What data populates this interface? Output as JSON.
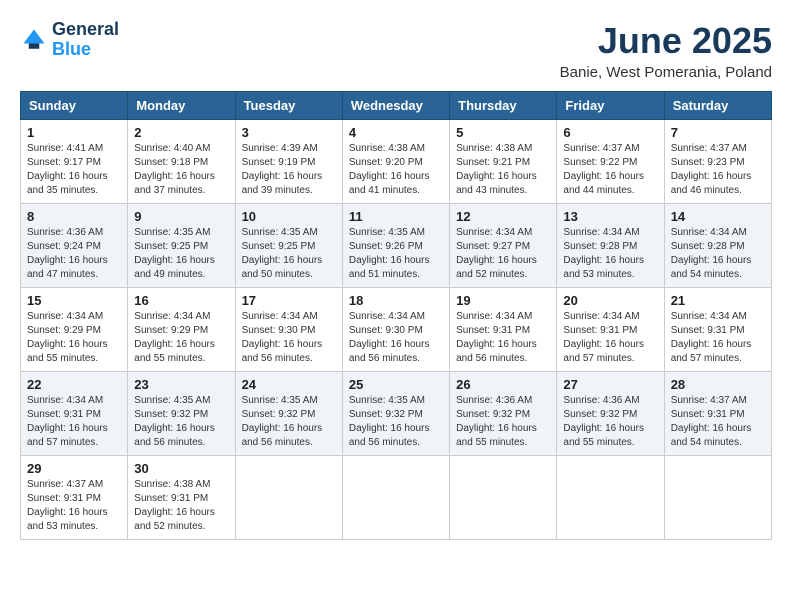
{
  "header": {
    "logo_line1": "General",
    "logo_line2": "Blue",
    "title": "June 2025",
    "subtitle": "Banie, West Pomerania, Poland"
  },
  "weekdays": [
    "Sunday",
    "Monday",
    "Tuesday",
    "Wednesday",
    "Thursday",
    "Friday",
    "Saturday"
  ],
  "weeks": [
    [
      {
        "day": "1",
        "sunrise": "4:41 AM",
        "sunset": "9:17 PM",
        "daylight": "16 hours and 35 minutes."
      },
      {
        "day": "2",
        "sunrise": "4:40 AM",
        "sunset": "9:18 PM",
        "daylight": "16 hours and 37 minutes."
      },
      {
        "day": "3",
        "sunrise": "4:39 AM",
        "sunset": "9:19 PM",
        "daylight": "16 hours and 39 minutes."
      },
      {
        "day": "4",
        "sunrise": "4:38 AM",
        "sunset": "9:20 PM",
        "daylight": "16 hours and 41 minutes."
      },
      {
        "day": "5",
        "sunrise": "4:38 AM",
        "sunset": "9:21 PM",
        "daylight": "16 hours and 43 minutes."
      },
      {
        "day": "6",
        "sunrise": "4:37 AM",
        "sunset": "9:22 PM",
        "daylight": "16 hours and 44 minutes."
      },
      {
        "day": "7",
        "sunrise": "4:37 AM",
        "sunset": "9:23 PM",
        "daylight": "16 hours and 46 minutes."
      }
    ],
    [
      {
        "day": "8",
        "sunrise": "4:36 AM",
        "sunset": "9:24 PM",
        "daylight": "16 hours and 47 minutes."
      },
      {
        "day": "9",
        "sunrise": "4:35 AM",
        "sunset": "9:25 PM",
        "daylight": "16 hours and 49 minutes."
      },
      {
        "day": "10",
        "sunrise": "4:35 AM",
        "sunset": "9:25 PM",
        "daylight": "16 hours and 50 minutes."
      },
      {
        "day": "11",
        "sunrise": "4:35 AM",
        "sunset": "9:26 PM",
        "daylight": "16 hours and 51 minutes."
      },
      {
        "day": "12",
        "sunrise": "4:34 AM",
        "sunset": "9:27 PM",
        "daylight": "16 hours and 52 minutes."
      },
      {
        "day": "13",
        "sunrise": "4:34 AM",
        "sunset": "9:28 PM",
        "daylight": "16 hours and 53 minutes."
      },
      {
        "day": "14",
        "sunrise": "4:34 AM",
        "sunset": "9:28 PM",
        "daylight": "16 hours and 54 minutes."
      }
    ],
    [
      {
        "day": "15",
        "sunrise": "4:34 AM",
        "sunset": "9:29 PM",
        "daylight": "16 hours and 55 minutes."
      },
      {
        "day": "16",
        "sunrise": "4:34 AM",
        "sunset": "9:29 PM",
        "daylight": "16 hours and 55 minutes."
      },
      {
        "day": "17",
        "sunrise": "4:34 AM",
        "sunset": "9:30 PM",
        "daylight": "16 hours and 56 minutes."
      },
      {
        "day": "18",
        "sunrise": "4:34 AM",
        "sunset": "9:30 PM",
        "daylight": "16 hours and 56 minutes."
      },
      {
        "day": "19",
        "sunrise": "4:34 AM",
        "sunset": "9:31 PM",
        "daylight": "16 hours and 56 minutes."
      },
      {
        "day": "20",
        "sunrise": "4:34 AM",
        "sunset": "9:31 PM",
        "daylight": "16 hours and 57 minutes."
      },
      {
        "day": "21",
        "sunrise": "4:34 AM",
        "sunset": "9:31 PM",
        "daylight": "16 hours and 57 minutes."
      }
    ],
    [
      {
        "day": "22",
        "sunrise": "4:34 AM",
        "sunset": "9:31 PM",
        "daylight": "16 hours and 57 minutes."
      },
      {
        "day": "23",
        "sunrise": "4:35 AM",
        "sunset": "9:32 PM",
        "daylight": "16 hours and 56 minutes."
      },
      {
        "day": "24",
        "sunrise": "4:35 AM",
        "sunset": "9:32 PM",
        "daylight": "16 hours and 56 minutes."
      },
      {
        "day": "25",
        "sunrise": "4:35 AM",
        "sunset": "9:32 PM",
        "daylight": "16 hours and 56 minutes."
      },
      {
        "day": "26",
        "sunrise": "4:36 AM",
        "sunset": "9:32 PM",
        "daylight": "16 hours and 55 minutes."
      },
      {
        "day": "27",
        "sunrise": "4:36 AM",
        "sunset": "9:32 PM",
        "daylight": "16 hours and 55 minutes."
      },
      {
        "day": "28",
        "sunrise": "4:37 AM",
        "sunset": "9:31 PM",
        "daylight": "16 hours and 54 minutes."
      }
    ],
    [
      {
        "day": "29",
        "sunrise": "4:37 AM",
        "sunset": "9:31 PM",
        "daylight": "16 hours and 53 minutes."
      },
      {
        "day": "30",
        "sunrise": "4:38 AM",
        "sunset": "9:31 PM",
        "daylight": "16 hours and 52 minutes."
      },
      null,
      null,
      null,
      null,
      null
    ]
  ]
}
